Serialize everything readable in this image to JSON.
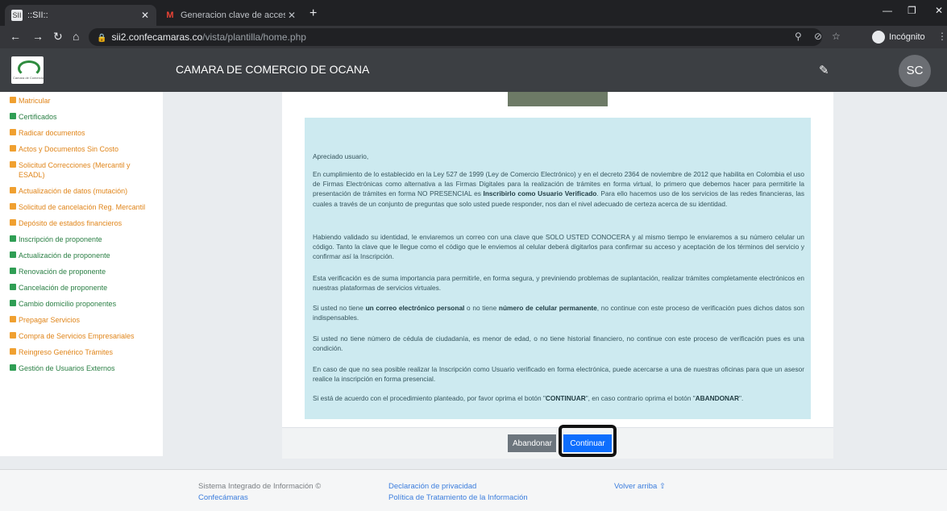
{
  "browser": {
    "tabs": [
      {
        "title": "::SII::",
        "favicon": "SII"
      },
      {
        "title": "Generacion clave de acceso - dav",
        "favicon": "M"
      }
    ],
    "new_tab": "+",
    "url_host": "sii2.confecamaras.co",
    "url_path": "/vista/plantilla/home.php",
    "incognito_label": "Incógnito",
    "accent_color": "#202124"
  },
  "app": {
    "title": "CAMARA DE COMERCIO DE OCANA",
    "user_initials": "SC",
    "logo_caption": "Camara de Comercio"
  },
  "sidebar": {
    "items": [
      {
        "label": "Matricular",
        "color": "orange"
      },
      {
        "label": "Certificados",
        "color": "green"
      },
      {
        "label": "Radicar documentos",
        "color": "orange"
      },
      {
        "label": "Actos y Documentos Sin Costo",
        "color": "orange"
      },
      {
        "label": "Solicitud Correcciones (Mercantil y ESADL)",
        "color": "orange"
      },
      {
        "label": "Actualización de datos (mutación)",
        "color": "orange"
      },
      {
        "label": "Solicitud de cancelación Reg. Mercantil",
        "color": "orange"
      },
      {
        "label": "Depósito de estados financieros",
        "color": "orange"
      },
      {
        "label": "Inscripción de proponente",
        "color": "green"
      },
      {
        "label": "Actualización de proponente",
        "color": "green"
      },
      {
        "label": "Renovación de proponente",
        "color": "green"
      },
      {
        "label": "Cancelación de proponente",
        "color": "green"
      },
      {
        "label": "Cambio domicilio proponentes",
        "color": "green"
      },
      {
        "label": "Prepagar Servicios",
        "color": "orange"
      },
      {
        "label": "Compra de Servicios Empresariales",
        "color": "orange"
      },
      {
        "label": "Reingreso Genérico Trámites",
        "color": "orange"
      },
      {
        "label": "Gestión de Usuarios Externos",
        "color": "green"
      }
    ]
  },
  "notice": {
    "greeting": "Apreciado usuario,",
    "p1_a": "En cumplimiento de lo establecido en la Ley 527 de 1999 (Ley de Comercio Electrónico) y en el decreto 2364 de noviembre de 2012 que habilita en Colombia el uso de Firmas Electrónicas como alternativa a las Firmas Digitales para la realización de trámites en forma virtual, lo primero que debemos hacer para permitirle la presentación de trámites en forma NO PRESENCIAL es ",
    "p1_b": "Inscribirlo como Usuario Verificado",
    "p1_c": ". Para ello hacemos uso de los servicios de las redes financieras, las cuales a través de un conjunto de preguntas que solo usted puede responder, nos dan el nivel adecuado de certeza acerca de su identidad.",
    "p2": "Habiendo validado su identidad, le enviaremos un correo con una clave que SOLO USTED CONOCERA y al mismo tiempo le enviaremos a su número celular un código. Tanto la clave que le llegue como el código que le enviemos al celular deberá digitarlos para confirmar su acceso y aceptación de los términos del servicio y confirmar así la Inscripción.",
    "p3": "Esta verificación es de suma importancia para permitirle, en forma segura, y previniendo problemas de suplantación, realizar trámites completamente electrónicos en nuestras plataformas de servicios virtuales.",
    "p4_a": "Si usted no tiene ",
    "p4_b": "un correo electrónico personal",
    "p4_c": " o no tiene ",
    "p4_d": "número de celular permanente",
    "p4_e": ", no continue con este proceso de verificación pues dichos datos son indispensables.",
    "p5": "Si usted no tiene número de cédula de ciudadanía, es menor de edad, o no tiene historial financiero, no continue con este proceso de verificación pues es una condición.",
    "p6": "En caso de que no sea posible realizar la Inscripción como Usuario verificado en forma electrónica, puede acercarse a una de nuestras oficinas para que un asesor realice la inscripción en forma presencial.",
    "p7_a": "Si está de acuerdo con el procedimiento planteado, por favor oprima el botón \"",
    "p7_b": "CONTINUAR",
    "p7_c": "\", en caso contrario oprima el botón \"",
    "p7_d": "ABANDONAR",
    "p7_e": "\"."
  },
  "buttons": {
    "abandon": "Abandonar",
    "continue": "Continuar"
  },
  "footer": {
    "system_line": "Sistema Integrado de Información ©",
    "confecamaras": "Confecámaras",
    "privacy": "Declaración de privacidad",
    "data_policy": "Política de Tratamiento de la Información",
    "back_top": "Volver arriba"
  }
}
